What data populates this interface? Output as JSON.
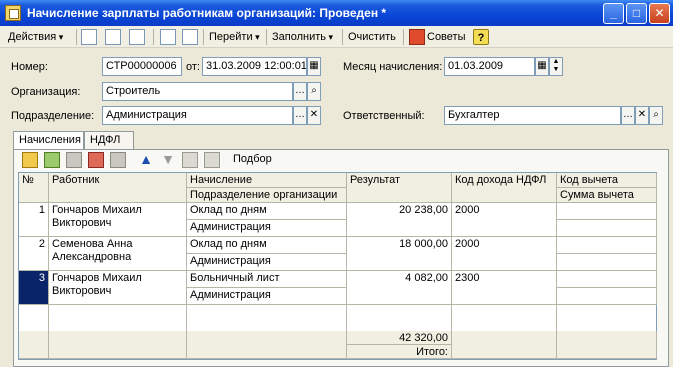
{
  "window": {
    "title": "Начисление зарплаты работникам организаций: Проведен *",
    "minimize": "_",
    "maximize": "□",
    "close": "✕"
  },
  "toolbar": {
    "actions": "Действия",
    "goto": "Перейти",
    "fill": "Заполнить",
    "clear": "Очистить",
    "tips": "Советы",
    "help": "?"
  },
  "form": {
    "number_label": "Номер:",
    "number_value": "СТР00000006",
    "date_label": "от:",
    "date_value": "31.03.2009 12:00:01",
    "month_label": "Месяц начисления:",
    "month_value": "01.03.2009",
    "org_label": "Организация:",
    "org_value": "Строитель",
    "dept_label": "Подразделение:",
    "dept_value": "Администрация",
    "resp_label": "Ответственный:",
    "resp_value": "Бухгалтер"
  },
  "tabs": [
    {
      "label": "Начисления"
    },
    {
      "label": "НДФЛ"
    }
  ],
  "grid_toolbar": {
    "pick": "Подбор"
  },
  "grid": {
    "headers": {
      "num": "№",
      "employee": "Работник",
      "accrual": "Начисление",
      "dept": "Подразделение организации",
      "result": "Результат",
      "income_code": "Код дохода НДФЛ",
      "deduction_code": "Код вычета",
      "deduction_sum": "Сумма вычета"
    },
    "rows": [
      {
        "num": "1",
        "employee1": "Гончаров Михаил",
        "employee2": "Викторович",
        "accrual": "Оклад по дням",
        "dept": "Администрация",
        "result": "20 238,00",
        "income_code": "2000"
      },
      {
        "num": "2",
        "employee1": "Семенова Анна",
        "employee2": "Александровна",
        "accrual": "Оклад по дням",
        "dept": "Администрация",
        "result": "18 000,00",
        "income_code": "2000"
      },
      {
        "num": "3",
        "employee1": "Гончаров Михаил",
        "employee2": "Викторович",
        "accrual": "Больничный лист",
        "dept": "Администрация",
        "result": "4 082,00",
        "income_code": "2300"
      }
    ],
    "total_value": "42 320,00",
    "total_label": "Итого:"
  }
}
